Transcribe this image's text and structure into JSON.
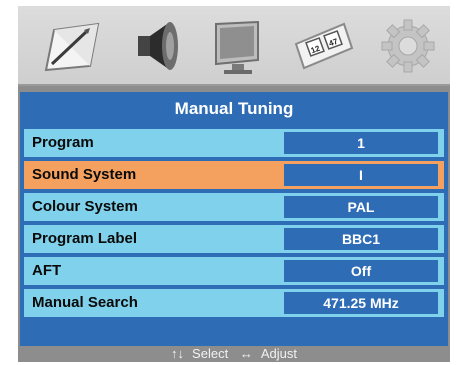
{
  "menu_icons": [
    {
      "name": "picture-icon"
    },
    {
      "name": "sound-icon"
    },
    {
      "name": "tv-icon"
    },
    {
      "name": "clock-icon"
    },
    {
      "name": "setup-gear-icon"
    }
  ],
  "clock_icon_text": [
    "12",
    "47"
  ],
  "panel": {
    "title": "Manual Tuning",
    "rows": [
      {
        "label": "Program",
        "value": "1"
      },
      {
        "label": "Sound System",
        "value": "I"
      },
      {
        "label": "Colour System",
        "value": "PAL"
      },
      {
        "label": "Program Label",
        "value": "BBC1"
      },
      {
        "label": "AFT",
        "value": "Off"
      },
      {
        "label": "Manual Search",
        "value": "471.25 MHz"
      }
    ],
    "selected_row": "Sound System"
  },
  "footer": {
    "select_arrows": "↑↓",
    "select_label": "Select",
    "adjust_arrows": "↔",
    "adjust_label": "Adjust"
  },
  "colors": {
    "panel_blue": "#2f6cb6",
    "row_cyan": "#7fd1ec",
    "row_selected": "#f4a15f"
  }
}
